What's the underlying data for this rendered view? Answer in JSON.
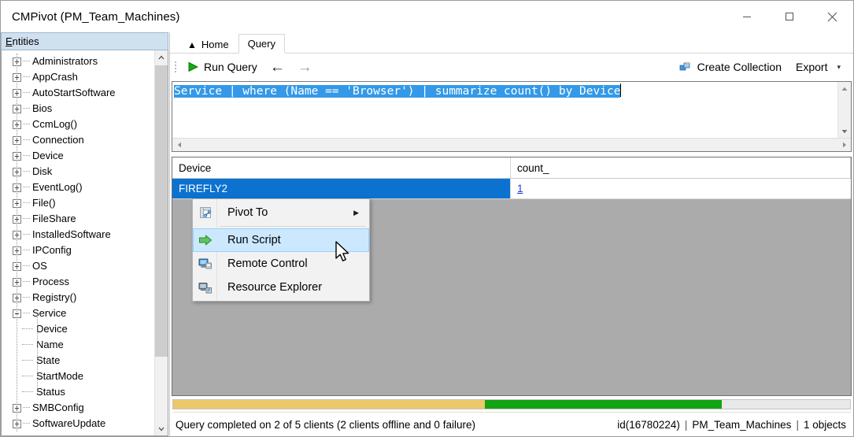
{
  "window": {
    "title": "CMPivot (PM_Team_Machines)",
    "controls": {
      "minimize": "—",
      "maximize": "□",
      "close": "✕"
    }
  },
  "entities_panel": {
    "header_accel": "E",
    "header_rest": "ntities",
    "nodes": [
      {
        "label": "Administrators",
        "type": "collapsed"
      },
      {
        "label": "AppCrash",
        "type": "collapsed"
      },
      {
        "label": "AutoStartSoftware",
        "type": "collapsed"
      },
      {
        "label": "Bios",
        "type": "collapsed"
      },
      {
        "label": "CcmLog()",
        "type": "collapsed"
      },
      {
        "label": "Connection",
        "type": "collapsed"
      },
      {
        "label": "Device",
        "type": "collapsed"
      },
      {
        "label": "Disk",
        "type": "collapsed"
      },
      {
        "label": "EventLog()",
        "type": "collapsed"
      },
      {
        "label": "File()",
        "type": "collapsed"
      },
      {
        "label": "FileShare",
        "type": "collapsed"
      },
      {
        "label": "InstalledSoftware",
        "type": "collapsed"
      },
      {
        "label": "IPConfig",
        "type": "collapsed"
      },
      {
        "label": "OS",
        "type": "collapsed"
      },
      {
        "label": "Process",
        "type": "collapsed"
      },
      {
        "label": "Registry()",
        "type": "collapsed"
      },
      {
        "label": "Service",
        "type": "expanded"
      },
      {
        "label": "Device",
        "type": "leaf"
      },
      {
        "label": "Name",
        "type": "leaf"
      },
      {
        "label": "State",
        "type": "leaf"
      },
      {
        "label": "StartMode",
        "type": "leaf"
      },
      {
        "label": "Status",
        "type": "leaf"
      },
      {
        "label": "SMBConfig",
        "type": "collapsed"
      },
      {
        "label": "SoftwareUpdate",
        "type": "collapsed"
      }
    ]
  },
  "tabs": [
    {
      "label": "Home",
      "icon": "home-icon",
      "active": false
    },
    {
      "label": "Query",
      "icon": "",
      "active": true
    }
  ],
  "toolbar": {
    "run_query_label": "Run Query",
    "back_arrow": "←",
    "forward_arrow": "→",
    "create_collection_label": "Create Collection",
    "export_label": "Export",
    "export_caret": "▾"
  },
  "editor": {
    "query_text": "Service | where (Name == 'Browser') | summarize count() by Device",
    "selected": true
  },
  "results": {
    "columns": [
      "Device",
      "count_"
    ],
    "rows": [
      {
        "device": "FIREFLY2",
        "count": "1"
      }
    ]
  },
  "context_menu": {
    "items": [
      {
        "label": "Pivot To",
        "icon": "pivot-to-icon",
        "submenu_arrow": "▶",
        "highlighted": false
      },
      {
        "label": "Run Script",
        "icon": "run-script-icon",
        "submenu_arrow": "",
        "highlighted": true
      },
      {
        "label": "Remote Control",
        "icon": "remote-control-icon",
        "submenu_arrow": "",
        "highlighted": false
      },
      {
        "label": "Resource Explorer",
        "icon": "resource-explorer-icon",
        "submenu_arrow": "",
        "highlighted": false
      }
    ]
  },
  "status": {
    "message": "Query completed on 2 of 5 clients (2 clients offline and 0 failure)",
    "id_text": "id(16780224)",
    "sep1": "|",
    "collection": "PM_Team_Machines",
    "sep2": "|",
    "objects": "1 objects",
    "progress": {
      "segments": [
        {
          "color": "#edc86a",
          "percent": 46
        },
        {
          "color": "#13a313",
          "percent": 35
        },
        {
          "color": "#e9e9e9",
          "percent": 19
        }
      ]
    }
  },
  "colors": {
    "selection_blue": "#0b72cf",
    "editor_selection": "#3399e8",
    "menu_highlight": "#cce8ff",
    "grid_empty": "#ababab",
    "entities_header": "#cfe0ef",
    "link_blue": "#1a3fd8",
    "progress_yellow": "#edc86a",
    "progress_green": "#13a313"
  }
}
